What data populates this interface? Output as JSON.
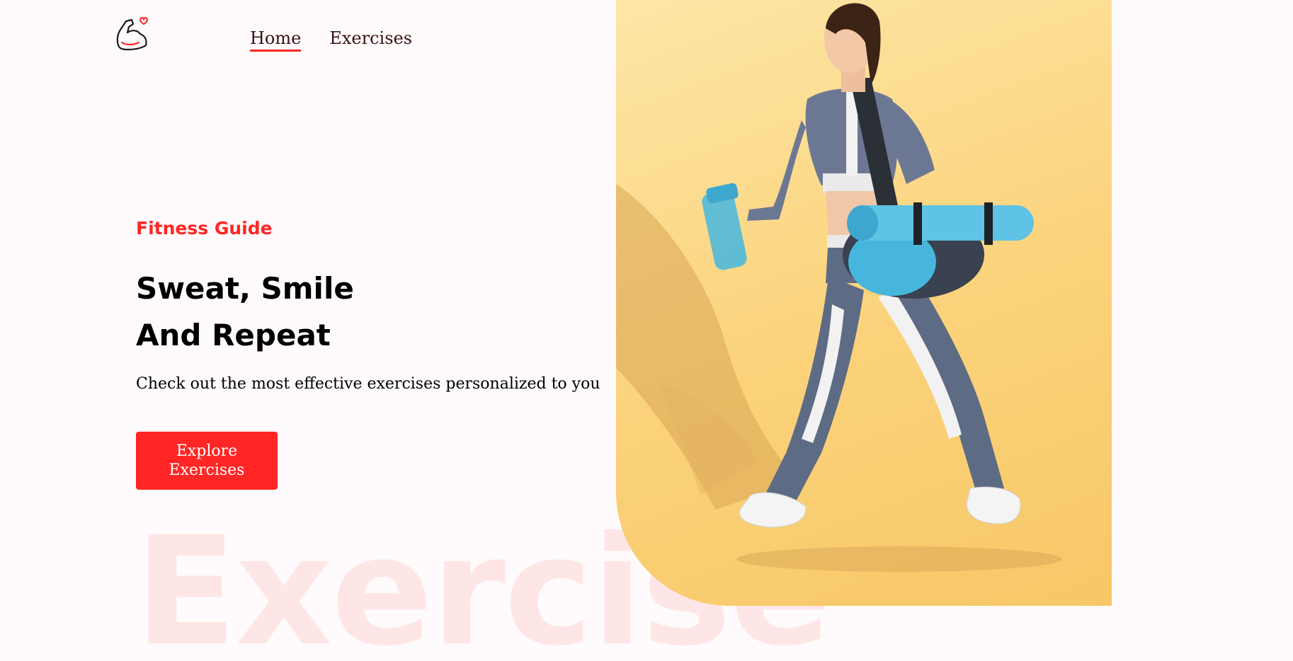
{
  "header": {
    "logo_icon": "flexed-arm-heart-icon",
    "nav": [
      {
        "label": "Home",
        "active": true
      },
      {
        "label": "Exercises",
        "active": false
      }
    ]
  },
  "hero": {
    "eyebrow": "Fitness Guide",
    "headline_line1": "Sweat, Smile",
    "headline_line2": "And Repeat",
    "subtext": "Check out the most effective exercises personalized to you",
    "cta_label": "Explore Exercises",
    "watermark": "Exercise",
    "image_icon": "woman-walking-with-gym-bag-image"
  },
  "colors": {
    "accent": "#ff2625",
    "background": "#fffafb",
    "image_background": "#fbd27a"
  }
}
